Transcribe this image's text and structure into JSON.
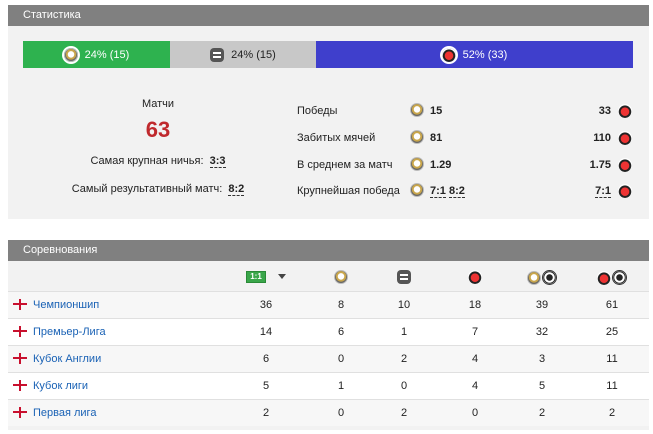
{
  "stats": {
    "header": "Статистика",
    "bar": [
      {
        "label": "24% (15)",
        "icon": "club-a-icon",
        "color": "#2eb24f",
        "share": 0.24
      },
      {
        "label": "24% (15)",
        "icon": "draw-icon",
        "color": "#c8c8c8",
        "share": 0.24
      },
      {
        "label": "52% (33)",
        "icon": "club-b-icon",
        "color": "#3f3fcc",
        "share": 0.52
      }
    ],
    "matches_label": "Матчи",
    "matches_value": "63",
    "biggest_draw_label": "Самая крупная ничья:",
    "biggest_draw_value": "3:3",
    "highest_scoring_label": "Самый результативный матч:",
    "highest_scoring_value": "8:2",
    "rows": [
      {
        "label": "Победы",
        "home": "15",
        "away": "33"
      },
      {
        "label": "Забитых мячей",
        "home": "81",
        "away": "110"
      },
      {
        "label": "В среднем за матч",
        "home": "1.29",
        "away": "1.75"
      },
      {
        "label": "Крупнейшая победа",
        "home_a": "7:1",
        "home_b": "8:2",
        "away": "7:1"
      }
    ]
  },
  "competitions": {
    "header": "Соревнования",
    "h2h_icon_text": "1:1",
    "columns": [
      "h2h-matches-icon",
      "club-a-wins-icon",
      "draws-icon",
      "club-b-wins-icon",
      "club-a-goals-icon",
      "club-b-goals-icon"
    ],
    "rows": [
      {
        "name": "Чемпионшип",
        "values": [
          "36",
          "8",
          "10",
          "18",
          "39",
          "61"
        ]
      },
      {
        "name": "Премьер-Лига",
        "values": [
          "14",
          "6",
          "1",
          "7",
          "32",
          "25"
        ]
      },
      {
        "name": "Кубок Англии",
        "values": [
          "6",
          "0",
          "2",
          "4",
          "3",
          "11"
        ]
      },
      {
        "name": "Кубок лиги",
        "values": [
          "5",
          "1",
          "0",
          "4",
          "5",
          "11"
        ]
      },
      {
        "name": "Первая лига",
        "values": [
          "2",
          "0",
          "2",
          "0",
          "2",
          "2"
        ]
      }
    ]
  },
  "colors": {
    "accent_red": "#c0292d",
    "link": "#1a62b5",
    "header_bg": "#808080"
  }
}
